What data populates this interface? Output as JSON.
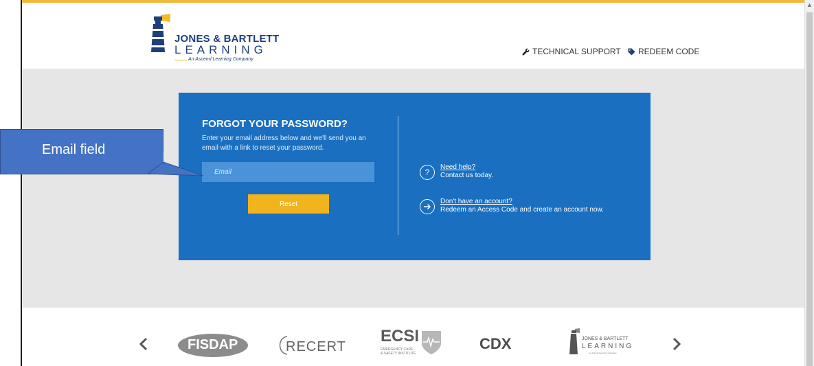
{
  "header": {
    "logo": {
      "line1": "JONES & BARTLETT",
      "line2": "LEARNING",
      "tagline": "An Ascend Learning Company"
    },
    "nav": {
      "technical_support": "TECHNICAL SUPPORT",
      "redeem_code": "REDEEM CODE"
    }
  },
  "form": {
    "title": "FORGOT YOUR PASSWORD?",
    "description": "Enter your email address below and we'll send you an email with a link to reset your password.",
    "email_placeholder": "Email",
    "email_value": "",
    "reset_label": "Reset"
  },
  "help": {
    "need_help_link": "Need help?",
    "need_help_text": "Contact us today.",
    "no_account_link": "Don't have an account?",
    "no_account_text": "Redeem an Access Code and create an account now."
  },
  "callout": {
    "label": "Email field"
  },
  "partners": {
    "fisdap": "FISDAP",
    "recert": "RECERT",
    "ecsi": "ECSI",
    "ecsi_sub1": "EMERGENCY CARE",
    "ecsi_sub2": "& SAFETY INSTITUTE",
    "cdx": "CDX",
    "jbl_line1": "JONES & BARTLETT",
    "jbl_line2": "LEARNING",
    "jbl_tagline": "An Ascend Learning Company"
  },
  "colors": {
    "card_blue": "#1a6fc0",
    "input_blue": "#4a93d9",
    "reset_yellow": "#f2b41c",
    "callout_blue": "#4472c4",
    "band_gray": "#e6e6e6",
    "brand_navy": "#1e3f7a"
  },
  "icons": {
    "support": "wrench-icon",
    "redeem": "tag-icon",
    "help": "question-circle-icon",
    "account": "arrow-circle-icon",
    "carousel_prev": "chevron-left-icon",
    "carousel_next": "chevron-right-icon"
  }
}
